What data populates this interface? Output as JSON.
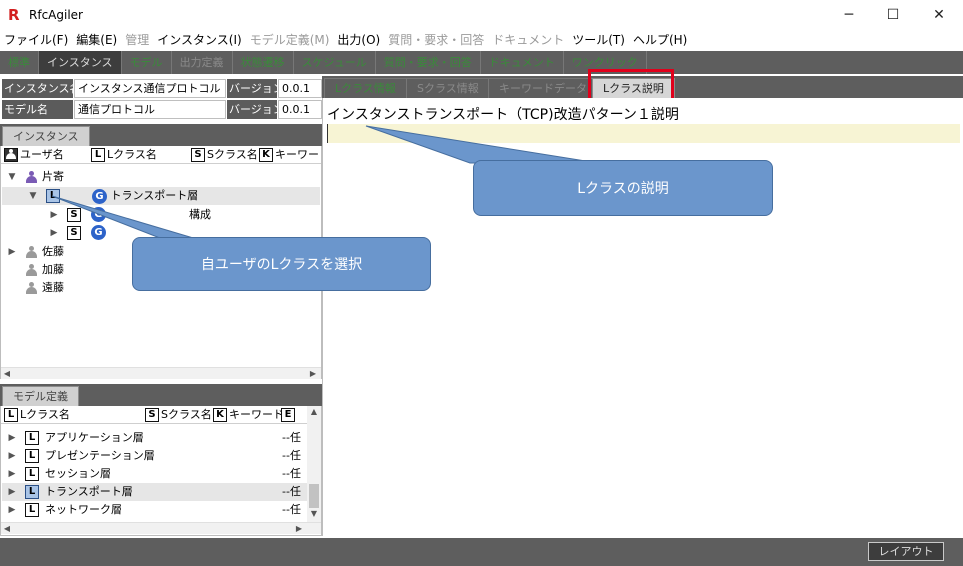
{
  "window": {
    "app_name": "RfcAgiler",
    "app_icon_letter": "R",
    "app_icon_color": "#d21f1f",
    "minimize": "─",
    "maximize": "☐",
    "close": "✕"
  },
  "menubar": [
    {
      "label": "ファイル(F)",
      "enabled": true
    },
    {
      "label": "編集(E)",
      "enabled": true
    },
    {
      "label": "管理",
      "enabled": false
    },
    {
      "label": "インスタンス(I)",
      "enabled": true
    },
    {
      "label": "モデル定義(M)",
      "enabled": false
    },
    {
      "label": "出力(O)",
      "enabled": true
    },
    {
      "label": "質問・要求・回答",
      "enabled": false
    },
    {
      "label": "ドキュメント",
      "enabled": false
    },
    {
      "label": "ツール(T)",
      "enabled": true
    },
    {
      "label": "ヘルプ(H)",
      "enabled": true
    }
  ],
  "main_tabs": [
    {
      "label": "標準",
      "state": "green"
    },
    {
      "label": "インスタンス",
      "state": "active"
    },
    {
      "label": "モデル",
      "state": "green"
    },
    {
      "label": "出力定義",
      "state": "dim"
    },
    {
      "label": "状態遷移",
      "state": "green"
    },
    {
      "label": "スケジュール",
      "state": "green"
    },
    {
      "label": "質問・要求・回答",
      "state": "green"
    },
    {
      "label": "ドキュメント",
      "state": "green"
    },
    {
      "label": "ワンクリック",
      "state": "green"
    }
  ],
  "instance_info": {
    "instance_label": "インスタンス名",
    "instance_value": "インスタンス通信プロトコル",
    "version_label": "バージョン",
    "version_value": "0.0.1",
    "model_label": "モデル名",
    "model_value": "通信プロトコル",
    "model_version_label": "バージョン",
    "model_version_value": "0.0.1"
  },
  "instance_panel": {
    "tab": "インスタンス",
    "columns": [
      "ユーザ名",
      "Lクラス名",
      "Sクラス名",
      "キーワード"
    ],
    "badge_user": "",
    "badge_L": "L",
    "badge_S": "S",
    "badge_K": "K",
    "badge_G": "G",
    "users": [
      {
        "name": "片寄",
        "expanded": true,
        "color": "#7a5bb5"
      },
      {
        "name": "佐藤",
        "expanded": false,
        "color": "#9a9a9a"
      },
      {
        "name": "加藤",
        "expanded": false,
        "color": "#9a9a9a"
      },
      {
        "name": "遠藤",
        "expanded": false,
        "color": "#9a9a9a"
      }
    ],
    "lclass_row": {
      "label": "トランスポート層"
    },
    "sclass_rows": [
      {
        "label": "構成"
      },
      {
        "label": ""
      }
    ]
  },
  "model_panel": {
    "tab": "モデル定義",
    "columns": [
      "Lクラス名",
      "Sクラス名",
      "キーワード",
      "E"
    ],
    "rows": [
      {
        "name": "アプリケーション層",
        "value": "--任",
        "selected": false
      },
      {
        "name": "プレゼンテーション層",
        "value": "--任",
        "selected": false
      },
      {
        "name": "セッション層",
        "value": "--任",
        "selected": false
      },
      {
        "name": "トランスポート層",
        "value": "--任",
        "selected": true
      },
      {
        "name": "ネットワーク層",
        "value": "--任",
        "selected": false
      }
    ]
  },
  "right_tabs": [
    {
      "label": "Lクラス情報",
      "state": "green"
    },
    {
      "label": "Sクラス情報",
      "state": "dim"
    },
    {
      "label": "キーワードデータ",
      "state": "dim"
    },
    {
      "label": "Lクラス説明",
      "state": "active"
    }
  ],
  "description": {
    "title": "インスタンストランスポート（TCP)改造パターン１説明",
    "edit_bg": "#f7f4d4"
  },
  "callouts": {
    "lclass_desc": "Lクラスの説明",
    "select_lclass": "自ユーザのLクラスを選択"
  },
  "highlight_color": "#e0001b",
  "statusbar": {
    "layout_button": "レイアウト"
  }
}
